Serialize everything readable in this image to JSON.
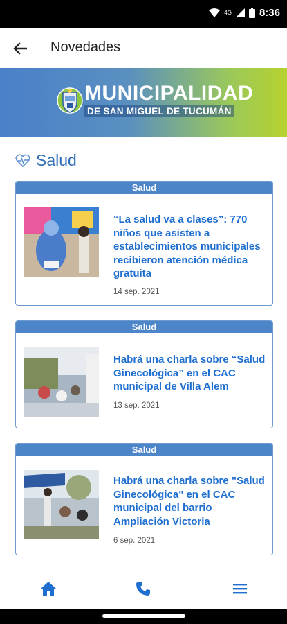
{
  "status_bar": {
    "time": "8:36",
    "network": "4G"
  },
  "app_bar": {
    "title": "Novedades"
  },
  "banner": {
    "line1": "MUNICIPALIDAD",
    "line2": "DE SAN MIGUEL DE TUCUMÁN"
  },
  "section": {
    "title": "Salud",
    "icon": "heart-pulse-icon"
  },
  "cards": [
    {
      "tag": "Salud",
      "title": "“La salud va a clases”: 770 niños que asisten a establecimientos municipales recibieron atención médica gratuita",
      "date": "14 sep. 2021"
    },
    {
      "tag": "Salud",
      "title": "Habrá una charla sobre “Salud Ginecológica” en el CAC municipal de Villa Alem",
      "date": "13 sep. 2021"
    },
    {
      "tag": "Salud",
      "title": "Habrá una charla sobre \"Salud Ginecológica\" en el CAC municipal del barrio Ampliación Victoria",
      "date": "6 sep. 2021"
    }
  ],
  "bottom_nav": {
    "icons": [
      "home-icon",
      "phone-icon",
      "menu-icon"
    ]
  },
  "colors": {
    "accent": "#2f6db5",
    "tag_bg": "#4d86c8",
    "link": "#1f6fd0"
  }
}
